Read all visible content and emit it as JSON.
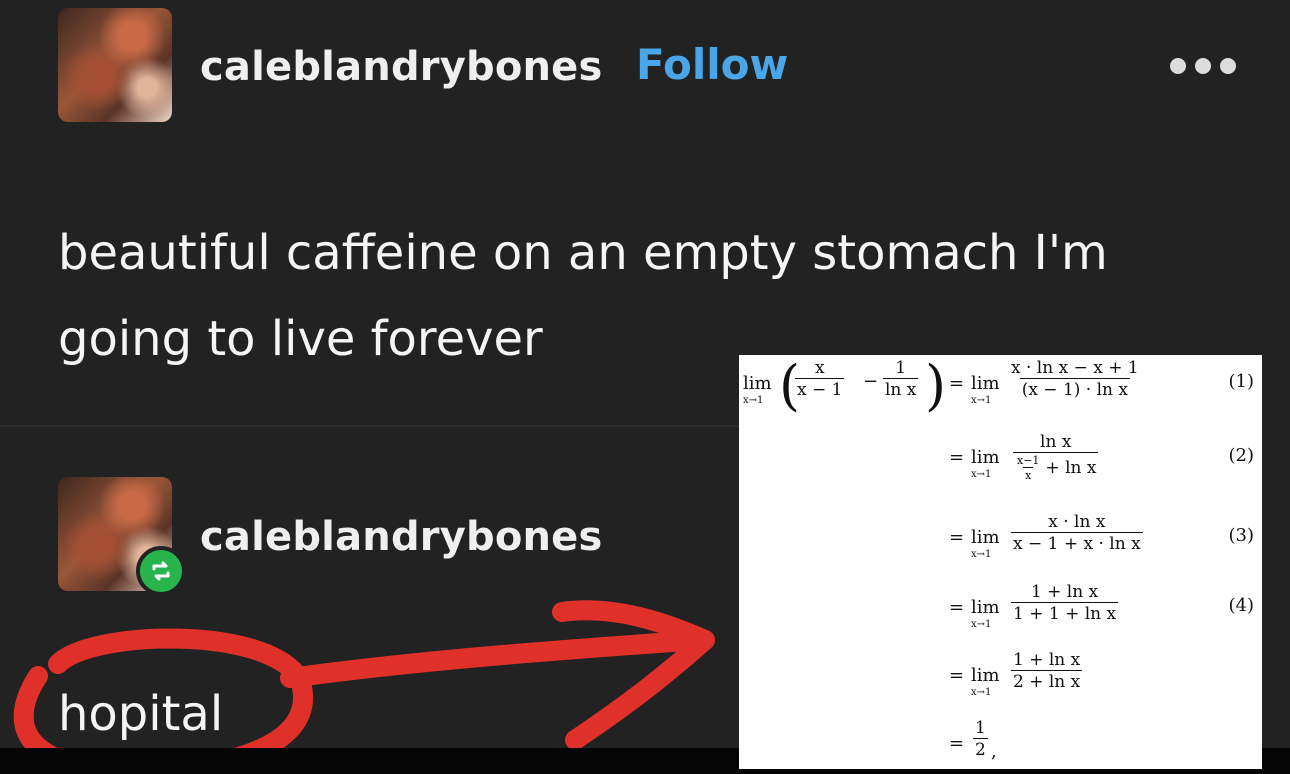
{
  "post": {
    "username": "caleblandrybones",
    "follow_label": "Follow",
    "more_icon": "more-horizontal-icon",
    "text_line1": "beautiful caffeine on an empty stomach I'm",
    "text_line2": "going to live forever"
  },
  "reblog": {
    "username": "caleblandrybones",
    "badge_icon": "reblog-icon",
    "reply_text": "hopital"
  },
  "annotation": {
    "stroke_color": "#e0302a",
    "shapes": [
      "circle-around-hopital",
      "arrow-to-proof"
    ]
  },
  "math_panel": {
    "rows": [
      {
        "lhs_lim": "lim",
        "lhs_sub": "x→1",
        "lhs_frac1_num": "x",
        "lhs_frac1_den": "x − 1",
        "lhs_frac2_num": "1",
        "lhs_frac2_den": "ln x",
        "eq": "=",
        "lim": "lim",
        "sub": "x→1",
        "num": "x · ln x − x + 1",
        "den": "(x − 1) · ln x",
        "tag": "(1)"
      },
      {
        "eq": "=",
        "lim": "lim",
        "sub": "x→1",
        "num": "ln x",
        "den_frac_num": "x−1",
        "den_frac_den": "x",
        "den_tail": "+ ln x",
        "tag": "(2)"
      },
      {
        "eq": "=",
        "lim": "lim",
        "sub": "x→1",
        "num": "x · ln x",
        "den": "x − 1 + x · ln x",
        "tag": "(3)"
      },
      {
        "eq": "=",
        "lim": "lim",
        "sub": "x→1",
        "num": "1 + ln x",
        "den": "1 + 1 + ln x",
        "tag": "(4)"
      },
      {
        "eq": "=",
        "lim": "lim",
        "sub": "x→1",
        "num": "1 + ln x",
        "den": "2 + ln x"
      },
      {
        "eq": "=",
        "num": "1",
        "den": "2",
        "tail": ","
      }
    ]
  }
}
